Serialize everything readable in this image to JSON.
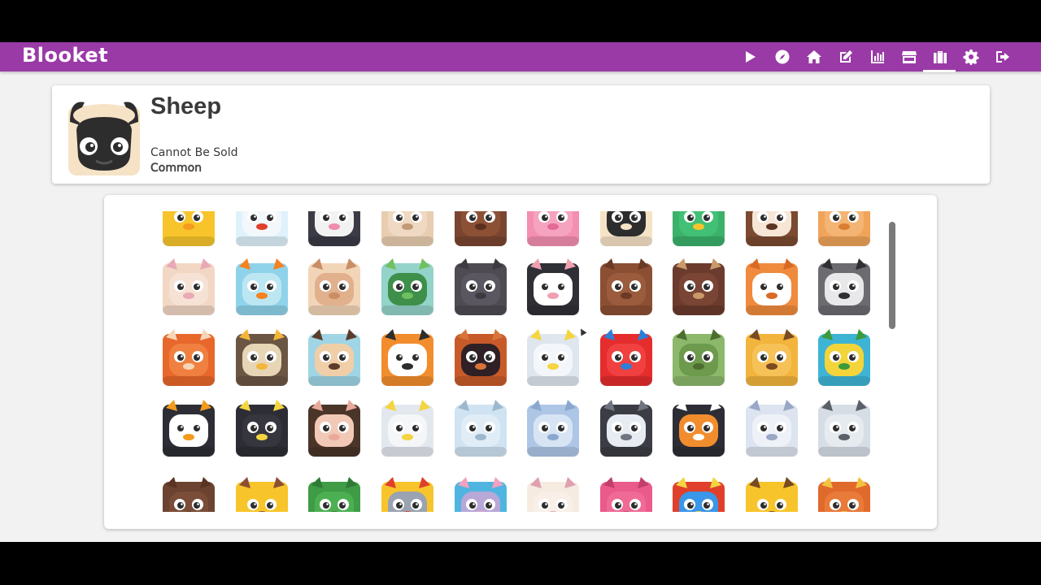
{
  "app": {
    "logo": "Blooket",
    "brand_color": "#9a3aa7"
  },
  "nav": {
    "items": [
      {
        "name": "play-icon",
        "icon": "play-icon"
      },
      {
        "name": "discover-icon",
        "icon": "compass-icon"
      },
      {
        "name": "home-icon",
        "icon": "home-icon"
      },
      {
        "name": "create-icon",
        "icon": "edit-icon"
      },
      {
        "name": "stats-icon",
        "icon": "chart-icon"
      },
      {
        "name": "market-icon",
        "icon": "store-icon"
      },
      {
        "name": "blooks-icon",
        "icon": "suitcase-icon",
        "active": true
      },
      {
        "name": "settings-icon",
        "icon": "gear-icon"
      },
      {
        "name": "logout-icon",
        "icon": "sign-out-icon"
      }
    ]
  },
  "selected": {
    "name": "Sheep",
    "sell_text": "Cannot Be Sold",
    "rarity": "Common"
  },
  "blooks": [
    {
      "icon": "chick",
      "bg": "#f7c52b",
      "face": "#f7c52b",
      "accent": "#f59b1d"
    },
    {
      "icon": "chicken",
      "bg": "#dff2fb",
      "face": "#f2f7fb",
      "accent": "#e0402b"
    },
    {
      "icon": "cow",
      "bg": "#3b3b46",
      "face": "#f2f2f2",
      "accent": "#f08cb0"
    },
    {
      "icon": "goat",
      "bg": "#e8cdb0",
      "face": "#f0d9c2",
      "accent": "#c39a78"
    },
    {
      "icon": "horse",
      "bg": "#7a4530",
      "face": "#8c5135",
      "accent": "#5a3020"
    },
    {
      "icon": "pig",
      "bg": "#f48fb1",
      "face": "#f5a3bf",
      "accent": "#e36a96"
    },
    {
      "icon": "sheep",
      "bg": "#f6e3c6",
      "face": "#2d2d2d",
      "accent": "#f6e3c6"
    },
    {
      "icon": "duck",
      "bg": "#3bb16a",
      "face": "#42c075",
      "accent": "#f7c52b"
    },
    {
      "icon": "dog",
      "bg": "#7b4a30",
      "face": "#f6e6d6",
      "accent": "#5a3323"
    },
    {
      "icon": "cat",
      "bg": "#f0a45a",
      "face": "#f4b473",
      "accent": "#d97f32"
    },
    {
      "icon": "bunny",
      "bg": "#f2d7c4",
      "face": "#f6e2d4",
      "accent": "#e9a9b6"
    },
    {
      "icon": "goldfish",
      "bg": "#8fd3ea",
      "face": "#bde6f3",
      "accent": "#f5811f"
    },
    {
      "icon": "hamster",
      "bg": "#f2d5b7",
      "face": "#e1b08c",
      "accent": "#c98e66"
    },
    {
      "icon": "turtle",
      "bg": "#93d3c9",
      "face": "#3d8f4a",
      "accent": "#70c060"
    },
    {
      "icon": "kitten",
      "bg": "#4e4b53",
      "face": "#5a5760",
      "accent": "#3d3a40"
    },
    {
      "icon": "puppy",
      "bg": "#2f2f36",
      "face": "#ffffff",
      "accent": "#f0a0b0"
    },
    {
      "icon": "bear",
      "bg": "#8b4f33",
      "face": "#9b5b3d",
      "accent": "#6a3a25"
    },
    {
      "icon": "moose",
      "bg": "#6b3b2d",
      "face": "#7a4535",
      "accent": "#c99a68"
    },
    {
      "icon": "fox",
      "bg": "#f08a3c",
      "face": "#ffffff",
      "accent": "#d86a25"
    },
    {
      "icon": "raccoon",
      "bg": "#6b6b70",
      "face": "#e8e8ea",
      "accent": "#2e2e33"
    },
    {
      "icon": "squirrel",
      "bg": "#e8672b",
      "face": "#f08040",
      "accent": "#f6d6b8"
    },
    {
      "icon": "owl",
      "bg": "#6b5644",
      "face": "#e6d6b6",
      "accent": "#f3b63a"
    },
    {
      "icon": "hedgehog",
      "bg": "#9fd5e5",
      "face": "#f0cfa8",
      "accent": "#5b3d2b"
    },
    {
      "icon": "tiger",
      "bg": "#f28d2e",
      "face": "#ffffff",
      "accent": "#2d2d2d"
    },
    {
      "icon": "orangutan",
      "bg": "#c85a2a",
      "face": "#2e2025",
      "accent": "#d8743a"
    },
    {
      "icon": "cockatoo",
      "bg": "#dfe6ee",
      "face": "#f3f6fa",
      "accent": "#f4d541"
    },
    {
      "icon": "parrot",
      "bg": "#e52d2d",
      "face": "#f04040",
      "accent": "#2e7fd8"
    },
    {
      "icon": "anaconda",
      "bg": "#8bb86a",
      "face": "#6d9a4c",
      "accent": "#4d6d2f"
    },
    {
      "icon": "jaguar",
      "bg": "#f2b43c",
      "face": "#f6c257",
      "accent": "#7a4a20"
    },
    {
      "icon": "macaw",
      "bg": "#3eb4d5",
      "face": "#f3d43a",
      "accent": "#3b9a3b"
    },
    {
      "icon": "toucan",
      "bg": "#2d2d35",
      "face": "#ffffff",
      "accent": "#f29b1d"
    },
    {
      "icon": "panther",
      "bg": "#2d2d35",
      "face": "#36363f",
      "accent": "#f4d541"
    },
    {
      "icon": "capuchin",
      "bg": "#4a3528",
      "face": "#f2c9b7",
      "accent": "#e8a99c"
    },
    {
      "icon": "snowy-owl",
      "bg": "#e3e8ee",
      "face": "#f4f6f8",
      "accent": "#f4d541"
    },
    {
      "icon": "polar-bear",
      "bg": "#cfe3f2",
      "face": "#e0edf7",
      "accent": "#9db8cc"
    },
    {
      "icon": "arctic-fox",
      "bg": "#aec6e6",
      "face": "#d7e4f4",
      "accent": "#8aa8cf"
    },
    {
      "icon": "baby-penguin",
      "bg": "#3c3c44",
      "face": "#e6ecf1",
      "accent": "#6e7580"
    },
    {
      "icon": "penguin",
      "bg": "#2d2d35",
      "face": "#f28d2e",
      "accent": "#ffffff"
    },
    {
      "icon": "arctic-hare",
      "bg": "#dde4f0",
      "face": "#eef2f8",
      "accent": "#9aa7c6"
    },
    {
      "icon": "seal",
      "bg": "#d6dde5",
      "face": "#e6ebf0",
      "accent": "#5a5f68"
    },
    {
      "icon": "walrus",
      "bg": "#6b4330",
      "face": "#7a4d38",
      "accent": "#5a3323"
    },
    {
      "icon": "cupcake",
      "bg": "#f7c52b",
      "face": "#f7c52b",
      "accent": "#8b4f33"
    },
    {
      "icon": "dragon",
      "bg": "#3f9b46",
      "face": "#4cb052",
      "accent": "#2f7a35"
    },
    {
      "icon": "elf",
      "bg": "#f7c52b",
      "face": "#9aa3b1",
      "accent": "#e0402b"
    },
    {
      "icon": "mouse",
      "bg": "#4fb5e0",
      "face": "#b8a8d8",
      "accent": "#f4a0c0"
    },
    {
      "icon": "bunny-lady",
      "bg": "#f6ebe0",
      "face": "#f8f0e8",
      "accent": "#e0a0b0"
    },
    {
      "icon": "pink-cat",
      "bg": "#ea5a8a",
      "face": "#f06a96",
      "accent": "#c0406a"
    },
    {
      "icon": "blue-blob",
      "bg": "#e0402b",
      "face": "#3a96e8",
      "accent": "#f4d541"
    },
    {
      "icon": "lord",
      "bg": "#f7c52b",
      "face": "#f7c52b",
      "accent": "#7a4a20"
    },
    {
      "icon": "waffle",
      "bg": "#e06a2b",
      "face": "#e87a3a",
      "accent": "#f4c241"
    }
  ]
}
